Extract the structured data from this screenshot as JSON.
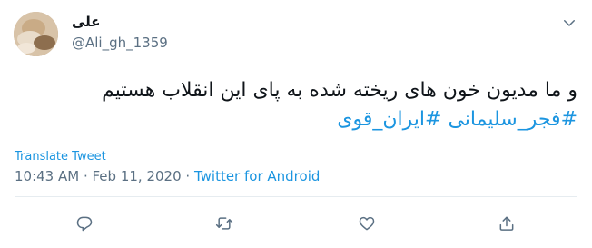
{
  "user": {
    "display_name": "علی",
    "handle": "@Ali_gh_1359"
  },
  "tweet": {
    "line1": "و ما مدیون خون های ریخته شده به پای این انقلاب هستیم",
    "hashtag1": "#فجر_سلیمانی",
    "hashtag2": "#ایران_قوی",
    "translate_label": "Translate Tweet",
    "timestamp": "10:43 AM · Feb 11, 2020",
    "separator": " · ",
    "source": "Twitter for Android"
  },
  "actions": [
    "reply-icon",
    "retweet-icon",
    "like-icon",
    "share-icon"
  ],
  "colors": {
    "link": "#1b95e0",
    "secondary": "#5b7083",
    "text": "#0f1419"
  }
}
